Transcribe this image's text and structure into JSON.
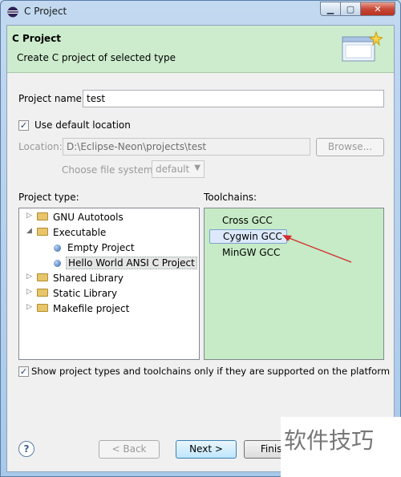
{
  "window": {
    "title": "C Project",
    "controls": {
      "minimize": "▁",
      "maximize": "▢",
      "close": "✕"
    }
  },
  "banner": {
    "title": "C Project",
    "description": "Create C project of selected type"
  },
  "project_name": {
    "label": "Project name:",
    "value": "test"
  },
  "default_location": {
    "label": "Use default location",
    "checked": true,
    "check_glyph": "✓"
  },
  "location": {
    "label": "Location:",
    "value": "D:\\Eclipse-Neon\\projects\\test",
    "browse_label": "Browse..."
  },
  "file_system": {
    "label": "Choose file system:",
    "value": "default",
    "arrow": "▼"
  },
  "project_type": {
    "label": "Project type:",
    "items": [
      {
        "label": "GNU Autotools",
        "twisty": "▷",
        "icon": "folder-icon"
      },
      {
        "label": "Executable",
        "twisty": "◢",
        "icon": "folder-icon"
      },
      {
        "label": "Empty Project",
        "twisty": "",
        "icon": "project-dot-icon"
      },
      {
        "label": "Hello World ANSI C Project",
        "twisty": "",
        "icon": "project-dot-icon",
        "selected": true
      },
      {
        "label": "Shared Library",
        "twisty": "▷",
        "icon": "folder-icon"
      },
      {
        "label": "Static Library",
        "twisty": "▷",
        "icon": "folder-icon"
      },
      {
        "label": "Makefile project",
        "twisty": "▷",
        "icon": "folder-icon"
      }
    ]
  },
  "toolchains": {
    "label": "Toolchains:",
    "items": [
      {
        "label": "Cross GCC"
      },
      {
        "label": "Cygwin GCC",
        "selected": true
      },
      {
        "label": "MinGW GCC"
      }
    ]
  },
  "show_supported": {
    "label": "Show project types and toolchains only if they are supported on the platform",
    "checked": true,
    "check_glyph": "✓"
  },
  "buttons": {
    "help": "?",
    "back": "< Back",
    "next": "Next >",
    "finish": "Finish"
  },
  "watermark": "软件技巧",
  "colors": {
    "banner_bg": "#cdeccd",
    "toolchain_bg": "#c6ebc6",
    "annotation_arrow": "#d42a2a"
  }
}
